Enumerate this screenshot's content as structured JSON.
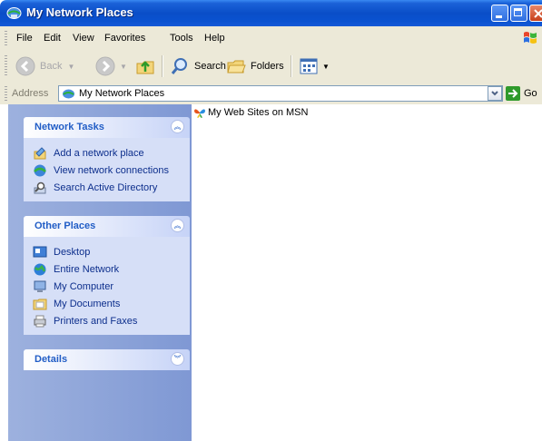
{
  "window": {
    "title": "My Network Places"
  },
  "menu": [
    "File",
    "Edit",
    "View",
    "Favorites",
    "Tools",
    "Help"
  ],
  "toolbar": {
    "back": "Back",
    "search": "Search",
    "folders": "Folders"
  },
  "address": {
    "label": "Address",
    "value": "My Network Places",
    "go": "Go"
  },
  "tasks": {
    "network_tasks": {
      "title": "Network Tasks",
      "items": [
        "Add a network place",
        "View network connections",
        "Search Active Directory"
      ]
    },
    "other_places": {
      "title": "Other Places",
      "items": [
        "Desktop",
        "Entire Network",
        "My Computer",
        "My Documents",
        "Printers and Faxes"
      ]
    },
    "details": {
      "title": "Details"
    }
  },
  "files": [
    "My Web Sites on MSN"
  ]
}
